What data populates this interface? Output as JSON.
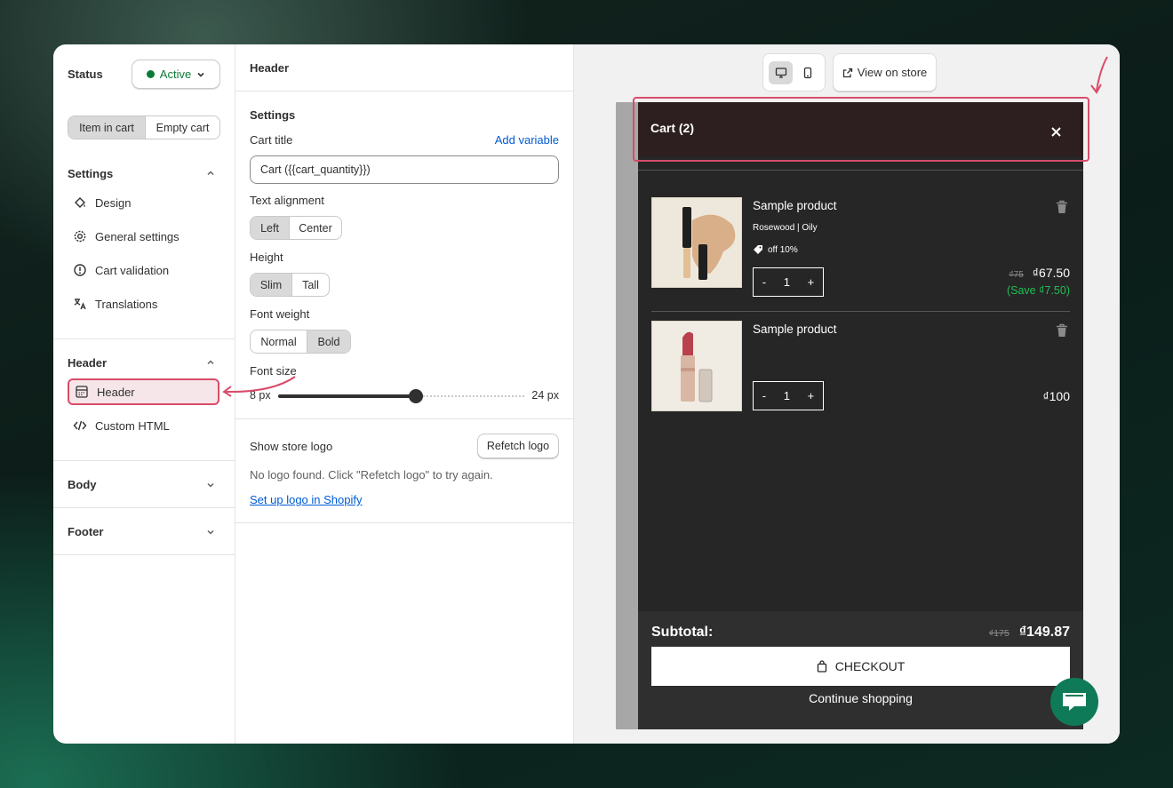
{
  "status": {
    "label": "Status",
    "value": "Active"
  },
  "preview_tabs": [
    "Item in cart",
    "Empty cart"
  ],
  "settings": {
    "title": "Settings",
    "items": [
      "Design",
      "General settings",
      "Cart validation",
      "Translations"
    ]
  },
  "header_section": {
    "title": "Header",
    "items": [
      "Header",
      "Custom HTML"
    ]
  },
  "body_section": {
    "title": "Body"
  },
  "footer_section": {
    "title": "Footer"
  },
  "panel": {
    "title": "Header",
    "settings_title": "Settings",
    "cart_title_label": "Cart title",
    "add_variable": "Add variable",
    "cart_title_value": "Cart ({{cart_quantity}})",
    "text_alignment_label": "Text alignment",
    "text_alignment_options": [
      "Left",
      "Center"
    ],
    "text_alignment_selected": "Left",
    "height_label": "Height",
    "height_options": [
      "Slim",
      "Tall"
    ],
    "height_selected": "Slim",
    "font_weight_label": "Font weight",
    "font_weight_options": [
      "Normal",
      "Bold"
    ],
    "font_weight_selected": "Bold",
    "font_size_label": "Font size",
    "font_size_min": "8 px",
    "font_size_max": "24 px",
    "font_size_fraction": 0.56,
    "store_logo_label": "Show store logo",
    "refetch_button": "Refetch logo",
    "no_logo_text": "No logo found. Click \"Refetch logo\" to try again.",
    "setup_logo_link": "Set up logo in Shopify"
  },
  "toolbar": {
    "view_on_store": "View on store",
    "device_icons": [
      "desktop-icon",
      "mobile-icon"
    ]
  },
  "cart": {
    "title": "Cart (2)",
    "items": [
      {
        "name": "Sample product",
        "variant": "Rosewood | Oily",
        "discount": "off 10%",
        "qty": "1",
        "old_price": "₫75",
        "price": "₫67.50",
        "save": "(Save ₫7.50)"
      },
      {
        "name": "Sample product",
        "variant": "",
        "discount": "",
        "qty": "1",
        "old_price": "",
        "price": "₫100",
        "save": ""
      }
    ],
    "subtotal_label": "Subtotal:",
    "subtotal_old": "₫175",
    "subtotal": "₫149.87",
    "checkout": "CHECKOUT",
    "continue": "Continue shopping",
    "qty_minus": "-",
    "qty_plus": "+"
  },
  "colors": {
    "accent": "#d94c6a",
    "active": "#0c7a36",
    "link": "#005bd3",
    "cart_bg": "#262626",
    "header_bg": "#2d1f1f",
    "save_green": "#1fbf55",
    "chat": "#0f7a57"
  }
}
